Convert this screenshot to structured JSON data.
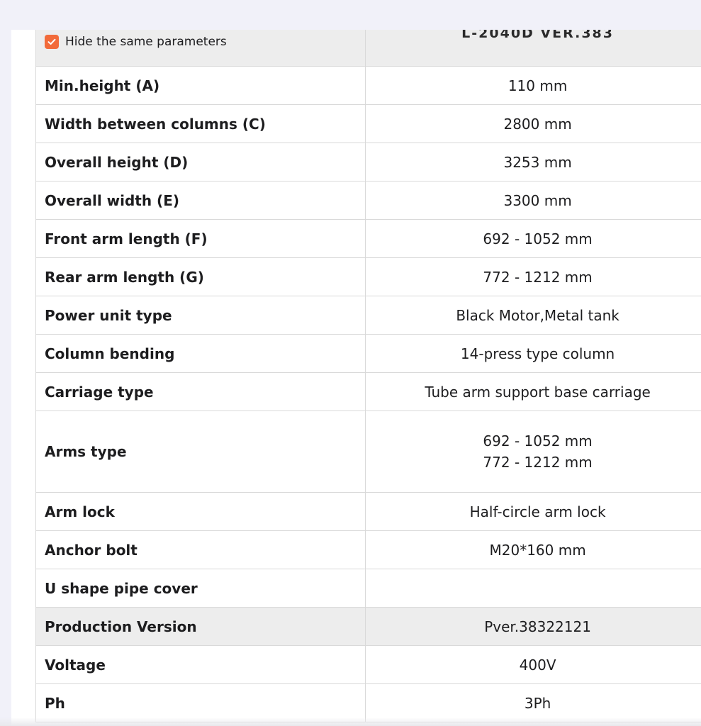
{
  "header": {
    "checkbox_label": "Hide the same parameters",
    "checkbox_checked": true,
    "model_name": "L-2040D VER.383",
    "accent_color": "#f26b3a"
  },
  "rows": [
    {
      "label": "Min.height (A)",
      "values": [
        "110 mm"
      ]
    },
    {
      "label": "Width between columns (C)",
      "values": [
        "2800 mm"
      ]
    },
    {
      "label": "Overall height (D)",
      "values": [
        "3253 mm"
      ]
    },
    {
      "label": "Overall width (E)",
      "values": [
        "3300 mm"
      ]
    },
    {
      "label": "Front arm length (F)",
      "values": [
        "692 - 1052 mm"
      ]
    },
    {
      "label": "Rear arm length (G)",
      "values": [
        "772 - 1212 mm"
      ]
    },
    {
      "label": "Power unit type",
      "values": [
        "Black Motor,Metal tank"
      ]
    },
    {
      "label": "Column bending",
      "values": [
        "14-press type column"
      ]
    },
    {
      "label": "Carriage type",
      "values": [
        "Tube arm support base carriage"
      ]
    },
    {
      "label": "Arms type",
      "values": [
        "692 - 1052 mm",
        "772 - 1212 mm"
      ]
    },
    {
      "label": "Arm lock",
      "values": [
        "Half-circle arm lock"
      ]
    },
    {
      "label": "Anchor bolt",
      "values": [
        "M20*160 mm"
      ]
    },
    {
      "label": "U shape pipe cover",
      "values": [
        ""
      ]
    },
    {
      "label": "Production Version",
      "values": [
        "Pver.38322121"
      ],
      "shaded": true
    },
    {
      "label": "Voltage",
      "values": [
        "400V"
      ]
    },
    {
      "label": "Ph",
      "values": [
        "3Ph"
      ]
    }
  ]
}
